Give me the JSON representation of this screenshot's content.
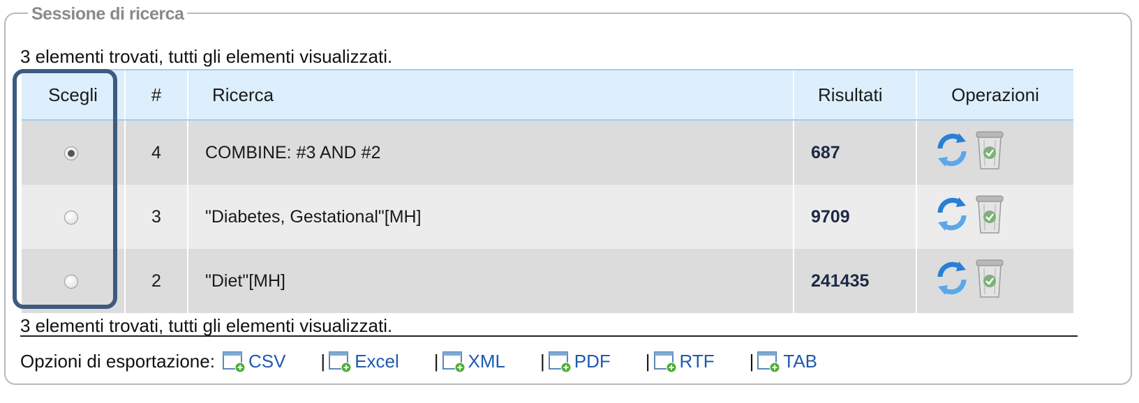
{
  "legend": "Sessione di ricerca",
  "status_top": "3 elementi trovati, tutti gli elementi visualizzati.",
  "status_bottom": "3 elementi trovati, tutti gli elementi visualizzati.",
  "table": {
    "headers": {
      "pick": "Scegli",
      "num": "#",
      "query": "Ricerca",
      "results": "Risultati",
      "ops": "Operazioni"
    },
    "rows": [
      {
        "num": "4",
        "query": "COMBINE: #3 AND #2",
        "results": "687",
        "selected": true
      },
      {
        "num": "3",
        "query": "\"Diabetes, Gestational\"[MH]",
        "results": "9709",
        "selected": false
      },
      {
        "num": "2",
        "query": "\"Diet\"[MH]",
        "results": "241435",
        "selected": false
      }
    ],
    "row_icons": [
      "refresh-icon",
      "trash-icon"
    ]
  },
  "export": {
    "label": "Opzioni di esportazione:",
    "separator": "|",
    "formats": [
      "CSV",
      "Excel",
      "XML",
      "PDF",
      "RTF",
      "TAB"
    ],
    "icon": "file-add-icon"
  },
  "colors": {
    "header_bg": "#ddeefc",
    "header_border": "#9fcff3",
    "row_dark": "#dcdcdc",
    "row_light": "#ececec",
    "highlight": "#3d5a80",
    "link": "#1e5ab0",
    "refresh_icon": "#2a7fd4",
    "trash_icon": "#7fb07a"
  }
}
